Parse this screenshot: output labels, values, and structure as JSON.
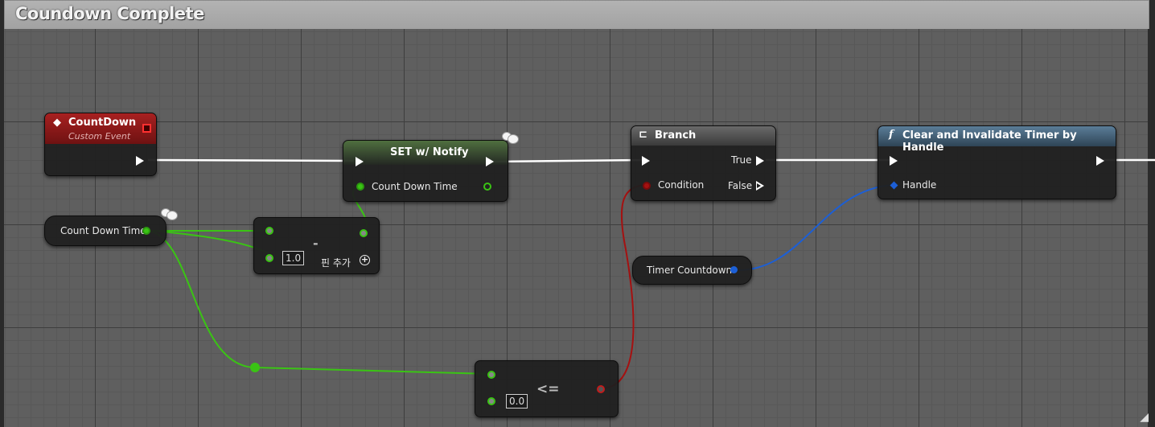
{
  "comment": {
    "title": "Coundown Complete"
  },
  "nodes": {
    "countdown_event": {
      "title": "CountDown",
      "subtitle": "Custom Event"
    },
    "set_notify": {
      "title": "SET w/ Notify",
      "var_label": "Count Down Time"
    },
    "get_countdown_time": {
      "label": "Count Down Time"
    },
    "subtract": {
      "op": "-",
      "value": "1.0",
      "add_pin_label": "핀 추가"
    },
    "less_equal": {
      "op": "<=",
      "value": "0.0"
    },
    "branch": {
      "title": "Branch",
      "condition_label": "Condition",
      "true_label": "True",
      "false_label": "False"
    },
    "clear_timer": {
      "title": "Clear and Invalidate Timer by Handle",
      "handle_label": "Handle"
    },
    "timer_countdown": {
      "label": "Timer Countdown"
    }
  },
  "colors": {
    "exec_wire": "#ffffff",
    "float_wire": "#3ac414",
    "bool_wire": "#a51111",
    "handle_wire": "#1c5fd6",
    "event_header": "#8e1a1a",
    "function_header": "#3e5e78",
    "branch_header": "#555555",
    "set_header": "#3e6a2a"
  },
  "icons": {
    "event": "event-diamond-icon",
    "branch": "branch-icon",
    "function": "function-f-icon",
    "add_pin": "plus-circle-icon",
    "replication": "cloud-icon"
  }
}
